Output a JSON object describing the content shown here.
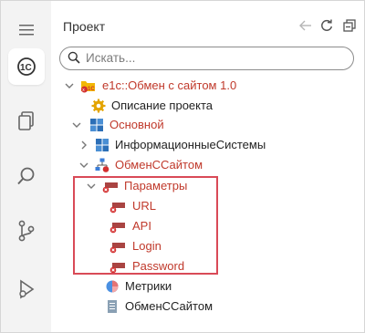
{
  "panel": {
    "title": "Проект",
    "search_placeholder": "Искать..."
  },
  "activity_bar": {
    "items": [
      "1c-icon",
      "files-icon",
      "search-icon",
      "source-control-icon",
      "run-debug-icon"
    ]
  },
  "tree": [
    {
      "label": "e1c::Обмен с сайтом 1.0",
      "color": "red",
      "icon": "project-folder-icon",
      "expanded": true
    },
    {
      "label": "Описание проекта",
      "color": "black",
      "icon": "gear-icon"
    },
    {
      "label": "Основной",
      "color": "red",
      "icon": "subsystem-icon",
      "expanded": true
    },
    {
      "label": "ИнформационныеСистемы",
      "color": "black",
      "icon": "subsystem-icon",
      "expanded": false
    },
    {
      "label": "ОбменССайтом",
      "color": "red",
      "icon": "exchange-icon",
      "expanded": true
    },
    {
      "label": "Параметры",
      "color": "red",
      "icon": "parameter-icon",
      "expanded": true
    },
    {
      "label": "URL",
      "color": "red",
      "icon": "parameter-icon"
    },
    {
      "label": "API",
      "color": "red",
      "icon": "parameter-icon"
    },
    {
      "label": "Login",
      "color": "red",
      "icon": "parameter-icon"
    },
    {
      "label": "Password",
      "color": "red",
      "icon": "parameter-icon"
    },
    {
      "label": "Метрики",
      "color": "black",
      "icon": "metrics-icon"
    },
    {
      "label": "ОбменССайтом",
      "color": "black",
      "icon": "document-icon"
    }
  ],
  "colors": {
    "accent": "#f7c300",
    "error_text": "#c0392b",
    "highlight_border": "#d94a57"
  }
}
